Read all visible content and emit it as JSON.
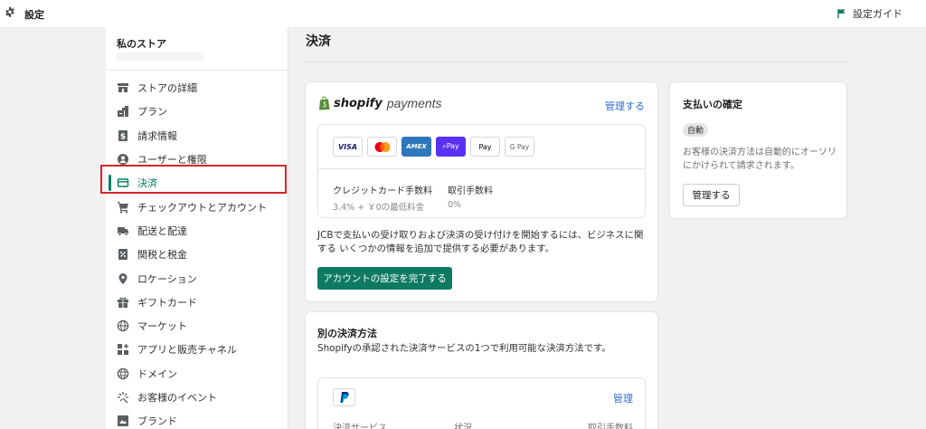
{
  "topbar": {
    "title": "設定",
    "guide_label": "設定ガイド"
  },
  "sidebar": {
    "store_name": "私のストア",
    "items": [
      {
        "label": "ストアの詳細",
        "icon": "store-icon"
      },
      {
        "label": "プラン",
        "icon": "plan-icon"
      },
      {
        "label": "請求情報",
        "icon": "billing-icon"
      },
      {
        "label": "ユーザーと権限",
        "icon": "user-icon"
      },
      {
        "label": "決済",
        "icon": "payments-icon",
        "active": true
      },
      {
        "label": "チェックアウトとアカウント",
        "icon": "cart-icon"
      },
      {
        "label": "配送と配達",
        "icon": "truck-icon"
      },
      {
        "label": "関税と税金",
        "icon": "tax-icon"
      },
      {
        "label": "ロケーション",
        "icon": "location-pin-icon"
      },
      {
        "label": "ギフトカード",
        "icon": "gift-icon"
      },
      {
        "label": "マーケット",
        "icon": "globe-icon"
      },
      {
        "label": "アプリと販売チャネル",
        "icon": "apps-icon"
      },
      {
        "label": "ドメイン",
        "icon": "domain-icon"
      },
      {
        "label": "お客様のイベント",
        "icon": "sparkle-icon"
      },
      {
        "label": "ブランド",
        "icon": "brand-icon"
      }
    ]
  },
  "main": {
    "title": "決済",
    "shopify_payments": {
      "brand": "shopify",
      "brand_suffix": "payments",
      "manage_label": "管理する",
      "methods": [
        "VISA",
        "Mastercard",
        "AMEX",
        "G Pay",
        "Apple Pay",
        "Google Pay"
      ],
      "method_text": {
        "visa": "VISA",
        "amex": "AMEX",
        "opay": "Pay",
        "apay": "Pay",
        "gpay": "G Pay"
      },
      "fees": [
        {
          "label": "クレジットカード手数料",
          "value": "3.4% + ￥0の最低料金"
        },
        {
          "label": "取引手数料",
          "value": "0%"
        }
      ],
      "notice": "JCBで支払いの受け取りおよび決済の受け付けを開始するには、ビジネスに関する いくつかの情報を追加で提供する必要があります。",
      "complete_button": "アカウントの設定を完了する"
    },
    "payment_confirm": {
      "title": "支払いの確定",
      "badge": "自動",
      "description": "お客様の決済方法は自動的にオーソリにかけられて請求されます。",
      "manage_button": "管理する"
    },
    "alternative": {
      "title": "別の決済方法",
      "subtitle": "Shopifyの承認された決済サービスの1つで利用可能な決済方法です。",
      "manage_label": "管理",
      "columns": [
        "決済サービス",
        "状況",
        "取引手数料"
      ]
    }
  },
  "colors": {
    "accent": "#008060",
    "primary_button": "#0f7a62",
    "link": "#2c6ecb",
    "highlight": "#d9242b"
  }
}
